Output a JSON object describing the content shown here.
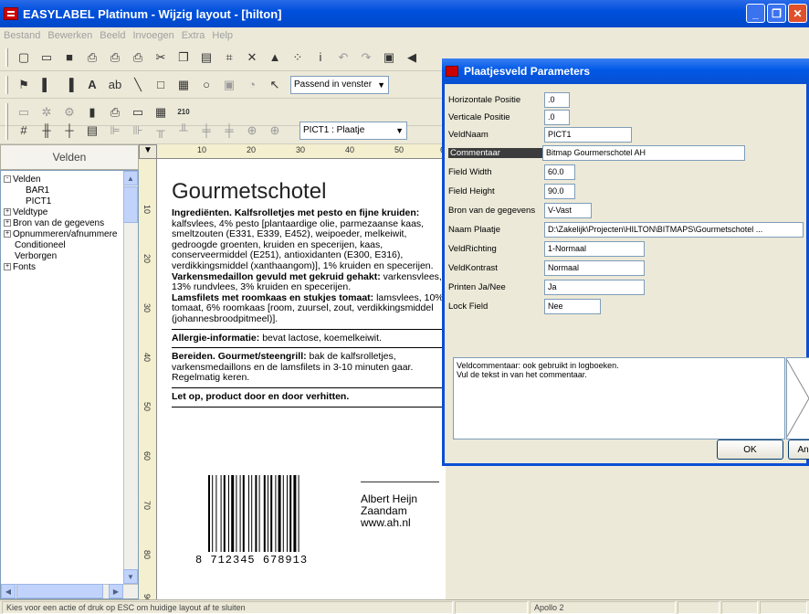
{
  "app": {
    "title": "EASYLABEL Platinum - Wijzig layout - [hilton]"
  },
  "menu": [
    "Bestand",
    "Bewerken",
    "Beeld",
    "Invoegen",
    "Extra",
    "Help"
  ],
  "toolbar": {
    "zoom": "Passend in venster",
    "field_select": "PICT1 : Plaatje",
    "icons": [
      "new-icon",
      "open-icon",
      "save-icon",
      "print-icon",
      "print-preview-icon",
      "cut-icon",
      "copy-icon",
      "paste-icon",
      "delete-icon",
      "lock-icon",
      "undo-icon",
      "redo-icon"
    ]
  },
  "left_panel": {
    "header": "Velden",
    "tree": [
      {
        "label": "Velden",
        "expanded": true,
        "level": 0,
        "toggle": "-"
      },
      {
        "label": "BAR1",
        "level": 2
      },
      {
        "label": "PICT1",
        "level": 2
      },
      {
        "label": "Veldtype",
        "level": 0,
        "toggle": "+"
      },
      {
        "label": "Bron van de gegevens",
        "level": 0,
        "toggle": "+"
      },
      {
        "label": "Opnummeren/afnummere",
        "level": 0,
        "toggle": "+"
      },
      {
        "label": "Conditioneel",
        "level": 1
      },
      {
        "label": "Verborgen",
        "level": 1
      },
      {
        "label": "Fonts",
        "level": 0,
        "toggle": "+"
      }
    ]
  },
  "ruler": {
    "top": [
      "10",
      "20",
      "30",
      "40",
      "50",
      "6"
    ],
    "left": [
      "10",
      "20",
      "30",
      "40",
      "50",
      "60",
      "70",
      "80",
      "90"
    ]
  },
  "label": {
    "title": "Gourmetschotel",
    "ingredients_head": "Ingrediënten. Kalfsrolletjes met pesto en fijne kruiden:",
    "ingredients": "kalfsvlees, 4% pesto [plantaardige olie, parmezaanse kaas, smeltzouten (E331, E339, E452), weipoeder, melkeiwit, gedroogde groenten, kruiden en specerijen, kaas, conserveermiddel (E251), antioxidanten (E300, E316), verdikkingsmiddel (xanthaangom)], 1% kruiden en specerijen.",
    "medaillon_head": "Varkensmedaillon gevuld met gekruid gehakt:",
    "medaillon": "varkensvlees, 13% rundvlees, 3% kruiden en specerijen.",
    "lamsfilets_head": "Lamsfilets met roomkaas en stukjes tomaat:",
    "lamsfilets": "lamsvlees, 10% tomaat, 6% roomkaas [room, zuursel, zout, verdikkingsmiddel (johannesbroodpitmeel)].",
    "allergy_head": "Allergie-informatie:",
    "allergy": "bevat lactose, koemelkeiwit.",
    "prep_head": "Bereiden. Gourmet/steengrill:",
    "prep": "bak de kalfsrolletjes, varkensmedaillons en de lamsfilets in 3-10 minuten gaar. Regelmatig keren.",
    "warning": "Let op, product door en door verhitten.",
    "barcode_first": "8",
    "barcode_digits": "712345 678913",
    "store": [
      "Albert Heijn",
      "Zaandam",
      "www.ah.nl"
    ]
  },
  "dialog": {
    "title": "Plaatjesveld Parameters",
    "fields": [
      {
        "label": "Horizontale Positie",
        "value": ".0"
      },
      {
        "label": "Verticale Positie",
        "value": ".0"
      },
      {
        "label": "VeldNaam",
        "value": "PICT1"
      },
      {
        "label": "Commentaar",
        "value": "Bitmap Gourmerschotel AH"
      },
      {
        "label": "Field Width",
        "value": "60.0"
      },
      {
        "label": "Field Height",
        "value": "90.0"
      },
      {
        "label": "Bron van de gegevens",
        "value": "V-Vast"
      },
      {
        "label": "Naam Plaatje",
        "value": "D:\\Zakelijk\\Projecten\\HILTON\\BITMAPS\\Gourmetschotel ..."
      },
      {
        "label": "VeldRichting",
        "value": "1-Normaal"
      },
      {
        "label": "VeldKontrast",
        "value": "Normaal"
      },
      {
        "label": "Printen Ja/Nee",
        "value": "Ja"
      },
      {
        "label": "Lock Field",
        "value": "Nee"
      }
    ],
    "help_line1": "Veldcommentaar: ook gebruikt in logboeken.",
    "help_line2": "Vul de tekst in van het commentaar.",
    "ok": "OK",
    "cancel": "Anr"
  },
  "status": {
    "message": "Kies voor een actie of druk op ESC om huidige layout af te sluiten",
    "printer": "Apollo 2"
  }
}
